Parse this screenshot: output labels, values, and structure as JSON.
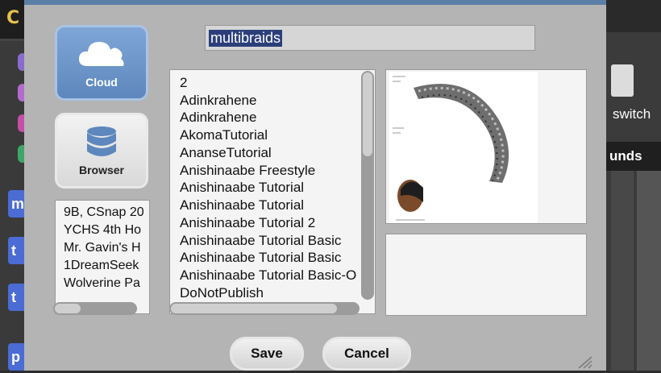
{
  "background": {
    "sidebar_blocks": [
      "m",
      "t",
      "t",
      "p"
    ],
    "right_label_switch": "switch",
    "right_label_sounds": "unds"
  },
  "dialog": {
    "sources": {
      "cloud_label": "Cloud",
      "browser_label": "Browser"
    },
    "project_name": "multibraids",
    "groups": [
      "9B, CSnap 20",
      "YCHS 4th Ho",
      "Mr. Gavin's H",
      "1DreamSeek",
      "Wolverine Pa"
    ],
    "projects": [
      "2",
      "Adinkrahene",
      "Adinkrahene",
      "AkomaTutorial",
      "AnanseTutorial",
      "Anishinaabe Freestyle",
      "Anishinaabe Tutorial",
      "Anishinaabe Tutorial",
      "Anishinaabe Tutorial 2",
      "Anishinaabe Tutorial Basic",
      "Anishinaabe Tutorial Basic",
      "Anishinaabe Tutorial Basic-O",
      "DoNotPublish"
    ],
    "buttons": {
      "save": "Save",
      "cancel": "Cancel"
    },
    "colors": {
      "dialog_bg": "#b4b4b4",
      "cloud_button": "#6b93c8",
      "selection": "#2c3f7a"
    }
  }
}
